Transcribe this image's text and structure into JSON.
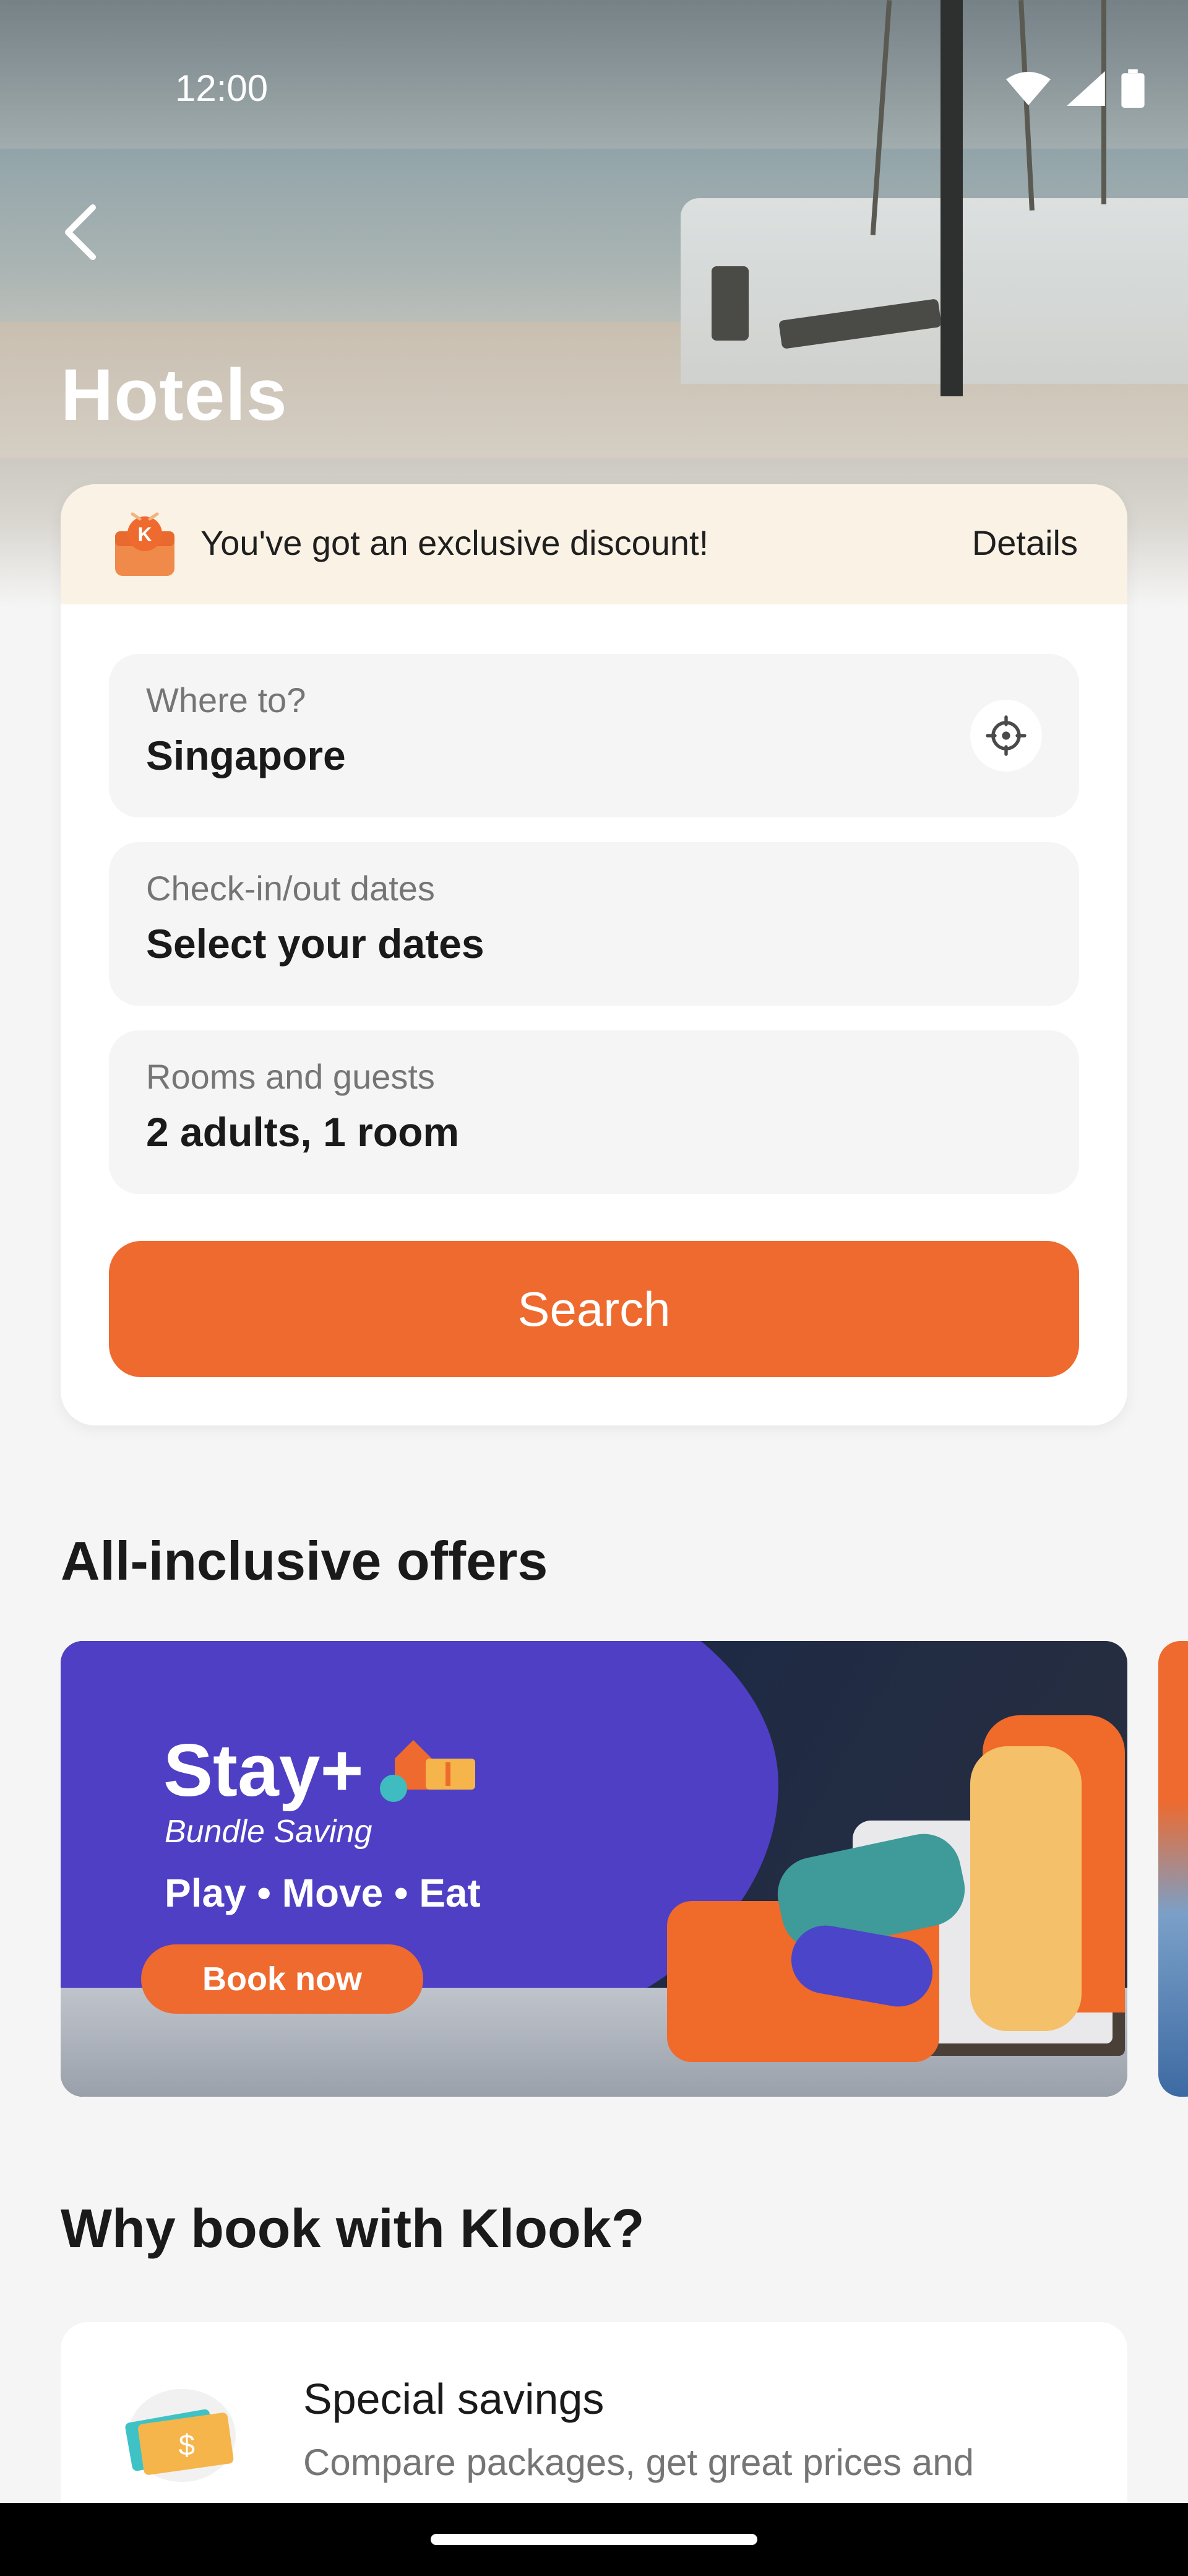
{
  "status_bar": {
    "time": "12:00",
    "icons": [
      "wifi-icon",
      "signal-icon",
      "battery-icon"
    ]
  },
  "header": {
    "back_icon": "chevron-left-icon",
    "title": "Hotels"
  },
  "discount_banner": {
    "icon": "gift-icon",
    "text": "You've got an exclusive discount!",
    "details_label": "Details"
  },
  "search_form": {
    "destination": {
      "label": "Where to?",
      "value": "Singapore",
      "icon": "locate-icon"
    },
    "dates": {
      "label": "Check-in/out dates",
      "value": "Select your dates"
    },
    "guests": {
      "label": "Rooms and guests",
      "value": "2 adults, 1 room"
    },
    "search_label": "Search"
  },
  "offers": {
    "title": "All-inclusive offers",
    "banner": {
      "headline": "Stay+",
      "subheadline": "Bundle Saving",
      "tagline": "Play  •  Move  •  Eat",
      "cta": "Book now"
    }
  },
  "why": {
    "title": "Why book with Klook?",
    "items": [
      {
        "icon": "savings-icon",
        "title": "Special savings",
        "description": "Compare packages, get great prices and"
      }
    ]
  },
  "colors": {
    "accent": "#ee6a2e",
    "banner_bg": "#faf2e4",
    "promo_purple": "#4e3fc4",
    "background": "#f5f5f5"
  }
}
